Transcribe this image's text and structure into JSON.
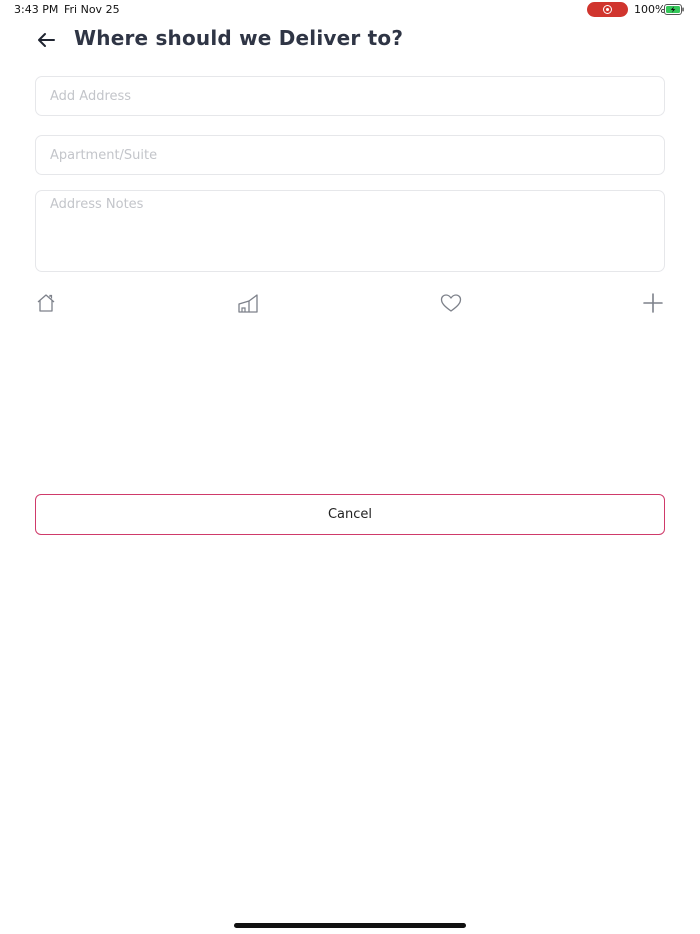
{
  "status_bar": {
    "time": "3:43 PM",
    "date": "Fri Nov 25",
    "battery_percent": "100%",
    "record_color": "#d0352e",
    "battery_color": "#34c759"
  },
  "header": {
    "back_icon": "arrow-left-icon",
    "title": "Where should we Deliver to?"
  },
  "form": {
    "address_placeholder": "Add Address",
    "address_value": "",
    "apartment_placeholder": "Apartment/Suite",
    "apartment_value": "",
    "notes_placeholder": "Address Notes",
    "notes_value": ""
  },
  "address_types": [
    {
      "icon": "home-icon"
    },
    {
      "icon": "building-icon"
    },
    {
      "icon": "heart-icon"
    },
    {
      "icon": "plus-icon"
    }
  ],
  "actions": {
    "cancel_label": "Cancel",
    "cancel_border_color": "#cf3a6a"
  }
}
